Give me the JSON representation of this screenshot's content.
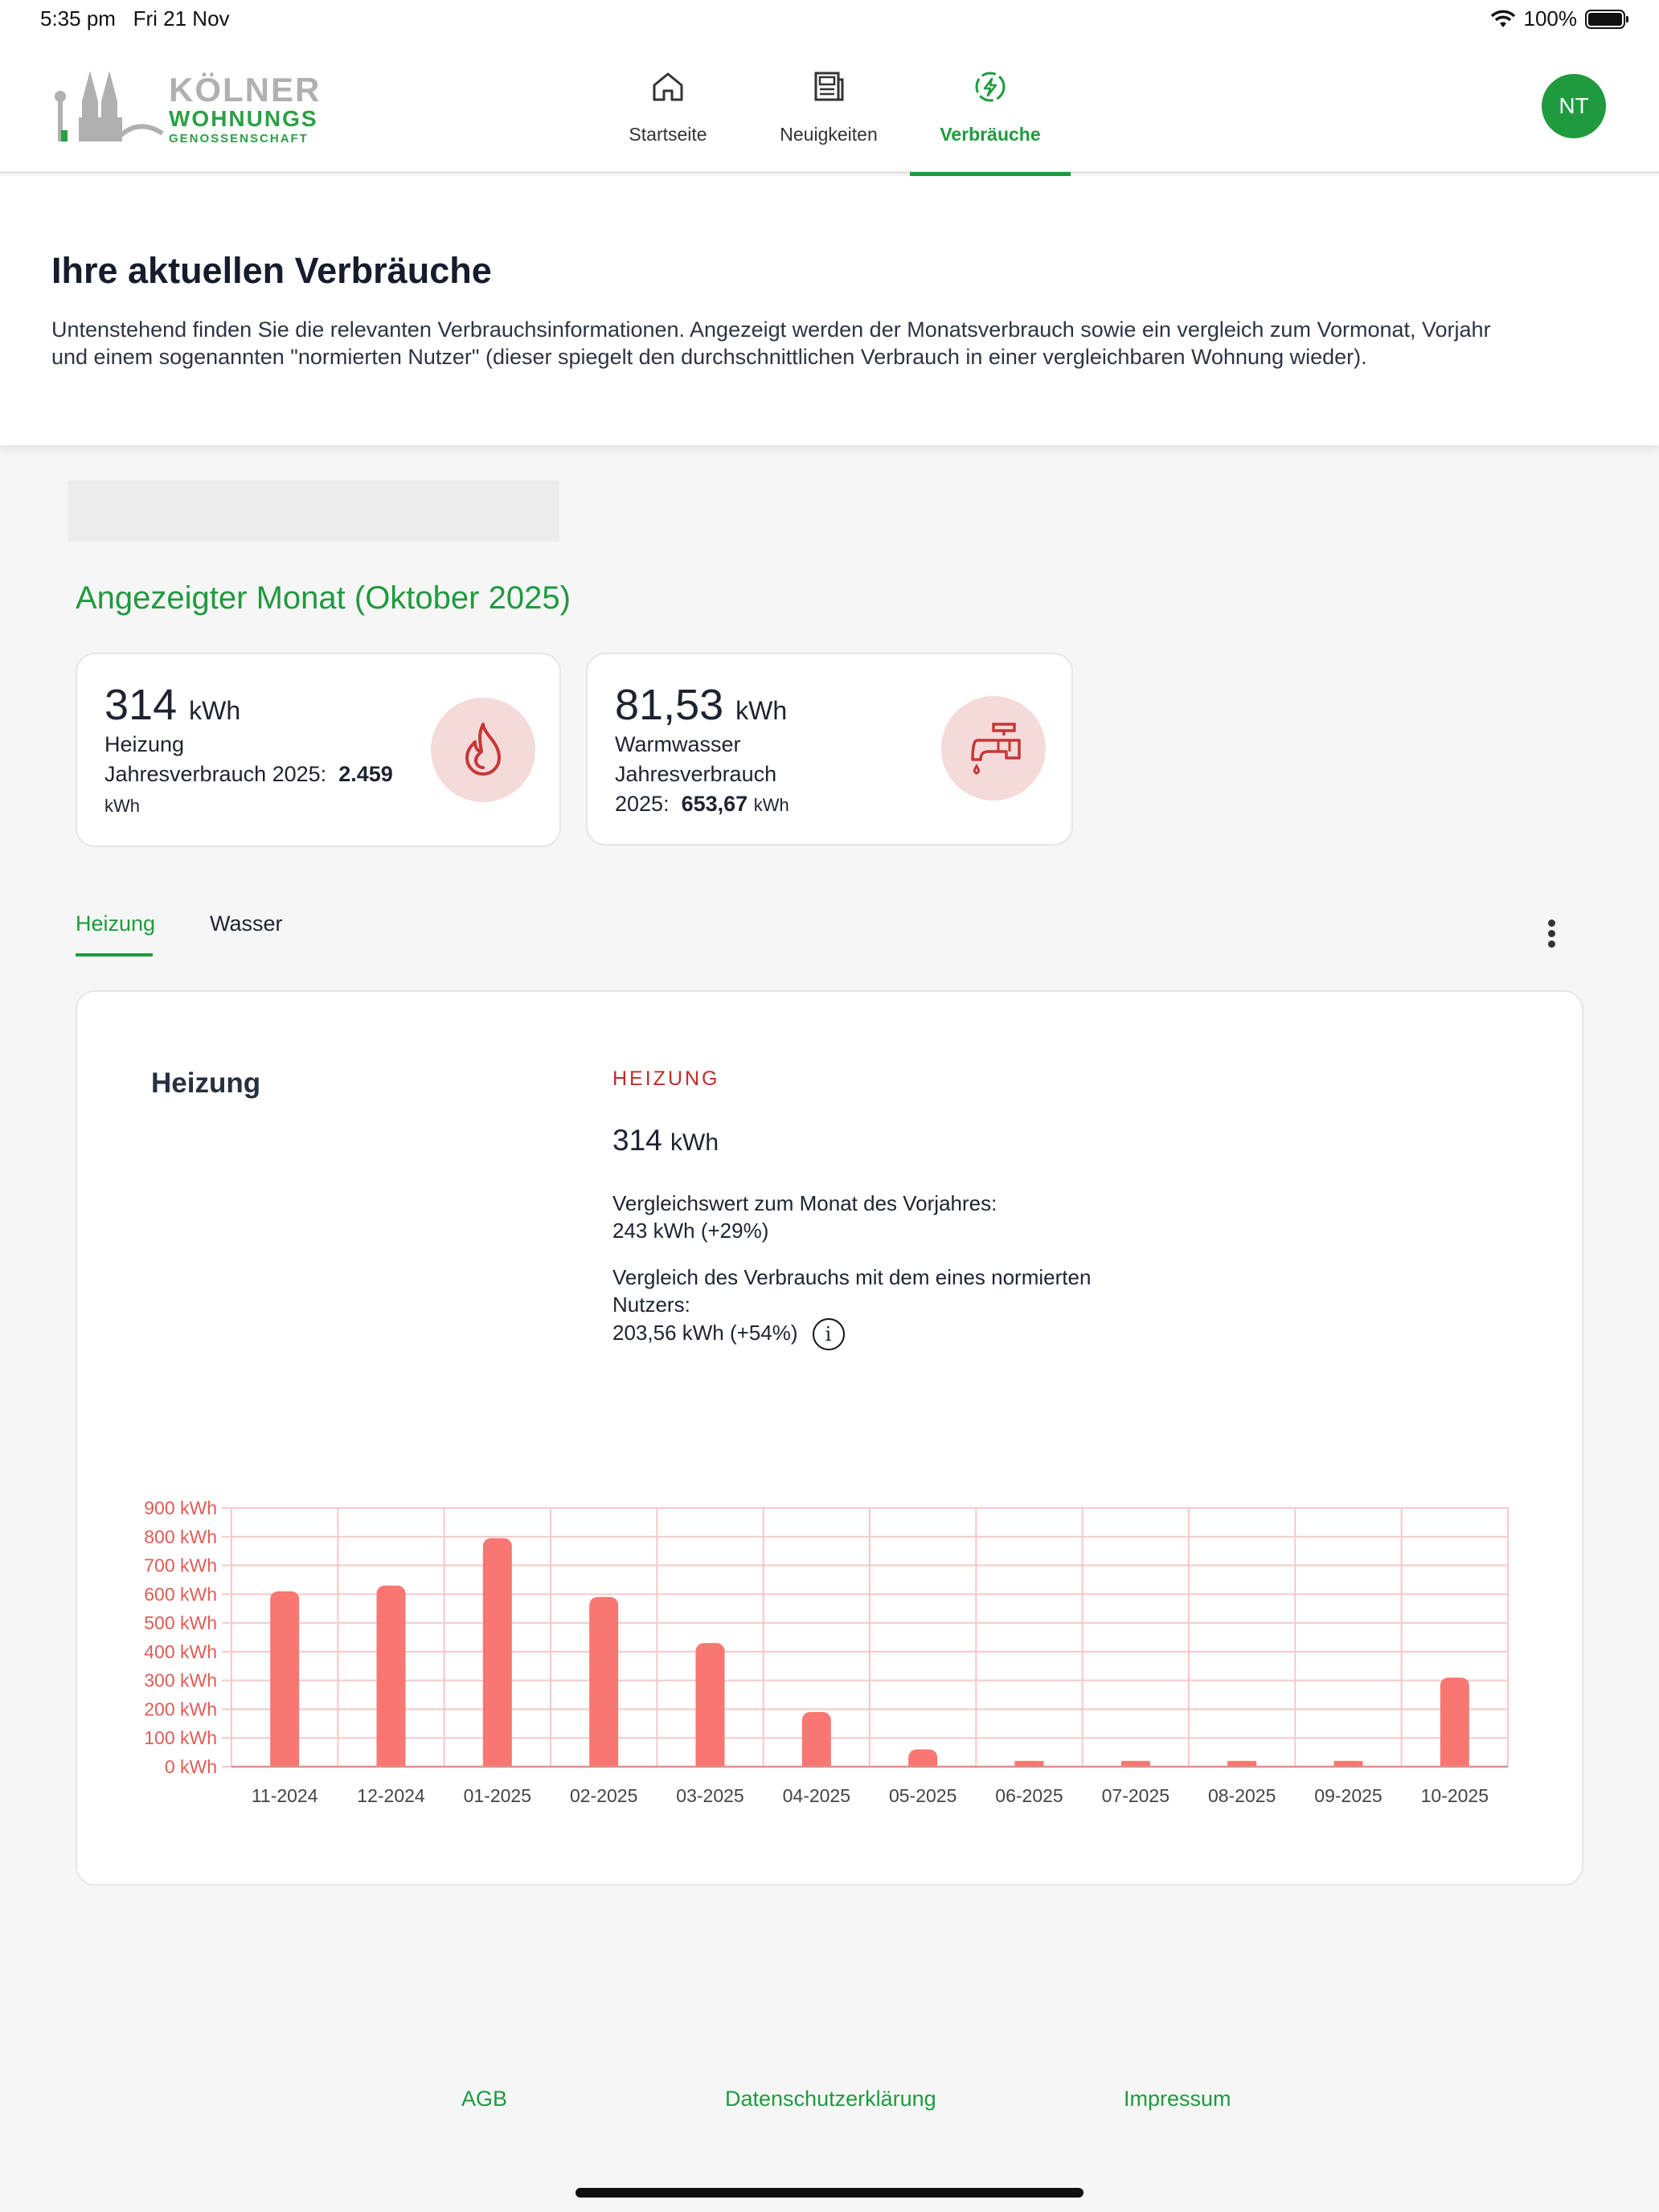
{
  "status_bar": {
    "time": "5:35 pm",
    "date": "Fri 21 Nov",
    "battery": "100%"
  },
  "header": {
    "logo": {
      "line1": "KÖLNER",
      "line2": "WOHNUNGS",
      "line3": "GENOSSENSCHAFT"
    },
    "nav": [
      {
        "label": "Startseite",
        "icon": "home-icon"
      },
      {
        "label": "Neuigkeiten",
        "icon": "news-icon"
      },
      {
        "label": "Verbräuche",
        "icon": "energy-icon",
        "active": true
      }
    ],
    "avatar": "NT"
  },
  "intro": {
    "title": "Ihre aktuellen Verbräuche",
    "text": "Untenstehend finden Sie die relevanten Verbrauchsinformationen. Angezeigt werden der Monatsverbrauch sowie ein vergleich zum Vormonat, Vorjahr und einem sogenannten \"normierten Nutzer\" (dieser spiegelt den durchschnittlichen Verbrauch in einer vergleichbaren Wohnung wieder)."
  },
  "month_title": "Angezeigter Monat (Oktober 2025)",
  "cards": [
    {
      "value": "314",
      "unit": "kWh",
      "label": "Heizung",
      "year_label": "Jahresverbrauch 2025:",
      "year_value": "2.459",
      "year_unit": "kWh",
      "icon": "flame-icon"
    },
    {
      "value": "81,53",
      "unit": "kWh",
      "label": "Warmwasser",
      "year_label_1": "Jahresverbrauch",
      "year_label_2": "2025:",
      "year_value": "653,67",
      "year_unit": "kWh",
      "icon": "faucet-icon"
    }
  ],
  "tabs": [
    {
      "label": "Heizung",
      "active": true
    },
    {
      "label": "Wasser"
    }
  ],
  "detail": {
    "title": "Heizung",
    "category": "HEIZUNG",
    "value": "314",
    "unit": "kWh",
    "prev_year_label": "Vergleichswert zum Monat des Vorjahres:",
    "prev_year_value": "243 kWh (+29%)",
    "norm_label_1": "Vergleich des Verbrauchs mit dem eines normierten",
    "norm_label_2": "Nutzers:",
    "norm_value": "203,56 kWh (+54%)",
    "info_glyph": "i"
  },
  "chart_data": {
    "type": "bar",
    "categories": [
      "11-2024",
      "12-2024",
      "01-2025",
      "02-2025",
      "03-2025",
      "04-2025",
      "05-2025",
      "06-2025",
      "07-2025",
      "08-2025",
      "09-2025",
      "10-2025"
    ],
    "values": [
      610,
      630,
      795,
      590,
      430,
      190,
      60,
      20,
      20,
      20,
      20,
      310
    ],
    "y_ticks": [
      "0 kWh",
      "100 kWh",
      "200 kWh",
      "300 kWh",
      "400 kWh",
      "500 kWh",
      "600 kWh",
      "700 kWh",
      "800 kWh",
      "900 kWh"
    ],
    "ylim": [
      0,
      900
    ],
    "grid": true,
    "bar_color": "#f87772",
    "grid_color": "#f5c9c7"
  },
  "footer": {
    "links": [
      "AGB",
      "Datenschutzerklärung",
      "Impressum"
    ]
  },
  "colors": {
    "accent": "#1f9a3e",
    "danger": "#c42a2a",
    "icon_bg": "#f5dada"
  }
}
